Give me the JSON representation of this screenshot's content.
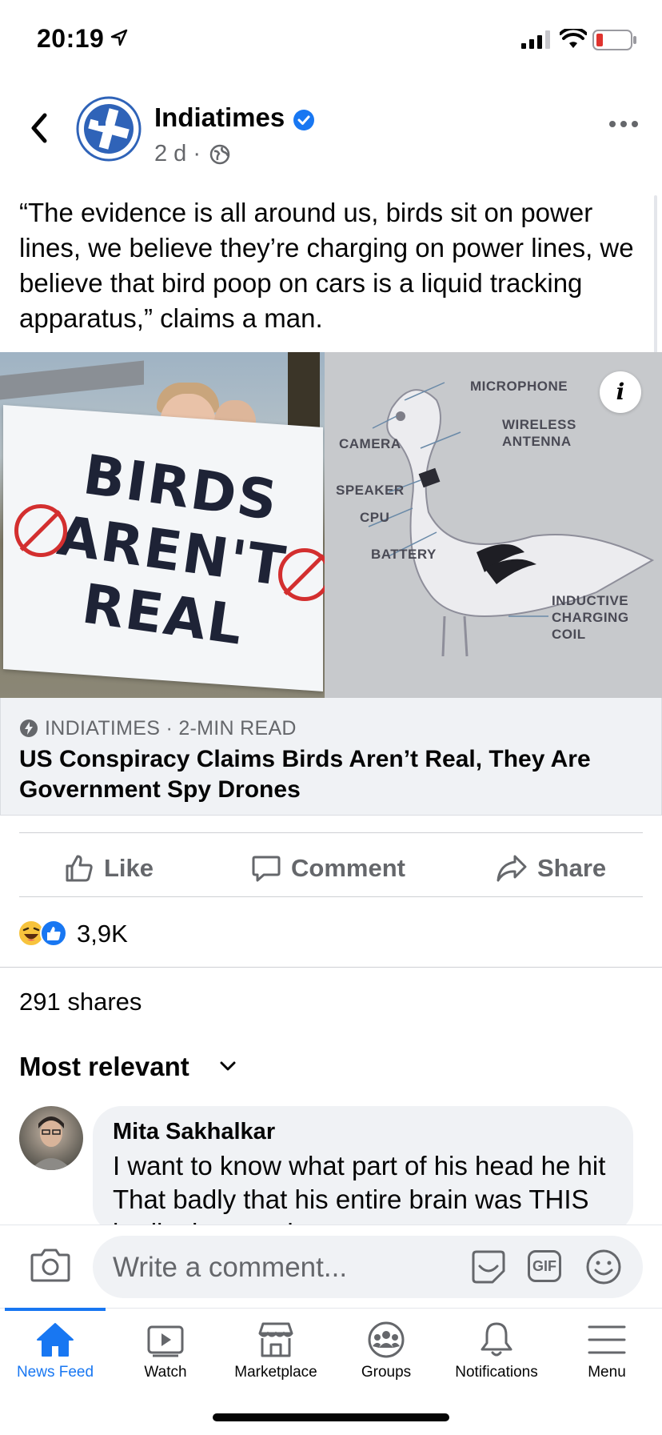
{
  "status_bar": {
    "time": "20:19"
  },
  "post": {
    "page_name": "Indiatimes",
    "meta": "2 d ·",
    "text": "“The evidence is all around us, birds sit on power lines, we believe they’re charging on power lines, we believe that bird poop on cars is a liquid tracking apparatus,” claims a man.",
    "image": {
      "banner_text": "BIRDS AREN'T REAL",
      "labels": {
        "microphone": "MICROPHONE",
        "wireless": "WIRELESS ANTENNA",
        "camera": "CAMERA",
        "speaker": "SPEAKER",
        "cpu": "CPU",
        "battery": "BATTERY",
        "coil": "INDUCTIVE CHARGING COIL"
      },
      "info_glyph": "i"
    },
    "link": {
      "source": "INDIATIMES · 2-MIN READ",
      "title": "US Conspiracy Claims Birds Aren’t Real, They Are Government Spy Drones"
    }
  },
  "actions": {
    "like": "Like",
    "comment": "Comment",
    "share": "Share"
  },
  "reactions": {
    "count": "3,9K"
  },
  "shares": "291 shares",
  "sort": {
    "label": "Most relevant"
  },
  "comment": {
    "author": "Mita Sakhalkar",
    "text": "I want to know what part of his head he hit That badly that his entire brain was THIS badly damaged"
  },
  "composer": {
    "placeholder": "Write a comment...",
    "gif": "GIF"
  },
  "tabs": [
    {
      "label": "News Feed",
      "icon": "home-icon",
      "active": true
    },
    {
      "label": "Watch",
      "icon": "watch-icon"
    },
    {
      "label": "Marketplace",
      "icon": "marketplace-icon"
    },
    {
      "label": "Groups",
      "icon": "groups-icon"
    },
    {
      "label": "Notifications",
      "icon": "bell-icon"
    },
    {
      "label": "Menu",
      "icon": "menu-icon"
    }
  ],
  "colors": {
    "brand_blue": "#1877f2",
    "secondary_text": "#65676b",
    "surface": "#f0f2f5"
  }
}
